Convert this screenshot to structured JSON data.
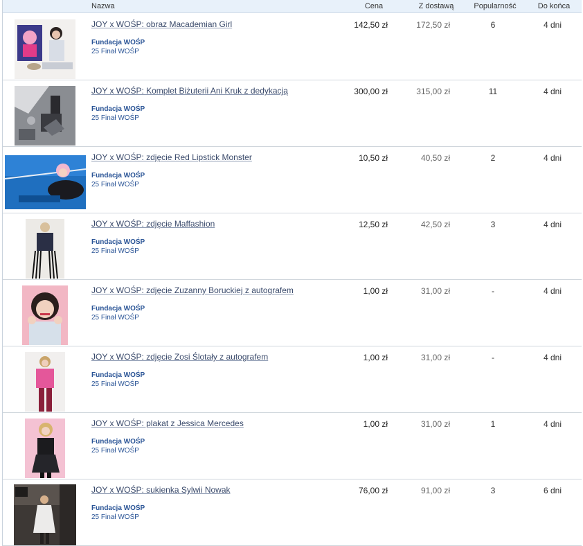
{
  "header": {
    "name": "Nazwa",
    "price": "Cena",
    "shipping": "Z dostawą",
    "popularity": "Popularność",
    "ends": "Do końca"
  },
  "items": [
    {
      "title": "JOY x WOŚP: obraz Macademian Girl",
      "seller": "Fundacja WOŚP",
      "subtitle": "25 Finał WOŚP",
      "price": "142,50 zł",
      "shipping": "172,50 zł",
      "popularity": "6",
      "ends": "4 dni"
    },
    {
      "title": "JOY x WOŚP: Komplet Biżuterii Ani Kruk z dedykacją",
      "seller": "Fundacja WOŚP",
      "subtitle": "25 Finał WOŚP",
      "price": "300,00 zł",
      "shipping": "315,00 zł",
      "popularity": "11",
      "ends": "4 dni"
    },
    {
      "title": "JOY x WOŚP: zdjęcie Red Lipstick Monster",
      "seller": "Fundacja WOŚP",
      "subtitle": "25 Finał WOŚP",
      "price": "10,50 zł",
      "shipping": "40,50 zł",
      "popularity": "2",
      "ends": "4 dni"
    },
    {
      "title": "JOY x WOŚP: zdjęcie Maffashion",
      "seller": "Fundacja WOŚP",
      "subtitle": "25 Finał WOŚP",
      "price": "12,50 zł",
      "shipping": "42,50 zł",
      "popularity": "3",
      "ends": "4 dni"
    },
    {
      "title": "JOY x WOŚP: zdjęcie Zuzanny Boruckiej z autografem",
      "seller": "Fundacja WOŚP",
      "subtitle": "25 Finał WOŚP",
      "price": "1,00 zł",
      "shipping": "31,00 zł",
      "popularity": "-",
      "ends": "4 dni"
    },
    {
      "title": "JOY x WOŚP: zdjęcie Zosi Ślotały z autografem",
      "seller": "Fundacja WOŚP",
      "subtitle": "25 Finał WOŚP",
      "price": "1,00 zł",
      "shipping": "31,00 zł",
      "popularity": "-",
      "ends": "4 dni"
    },
    {
      "title": "JOY x WOŚP: plakat z Jessica Mercedes",
      "seller": "Fundacja WOŚP",
      "subtitle": "25 Finał WOŚP",
      "price": "1,00 zł",
      "shipping": "31,00 zł",
      "popularity": "1",
      "ends": "4 dni"
    },
    {
      "title": "JOY x WOŚP: sukienka Sylwii Nowak",
      "seller": "Fundacja WOŚP",
      "subtitle": "25 Finał WOŚP",
      "price": "76,00 zł",
      "shipping": "91,00 zł",
      "popularity": "3",
      "ends": "6 dni"
    }
  ]
}
